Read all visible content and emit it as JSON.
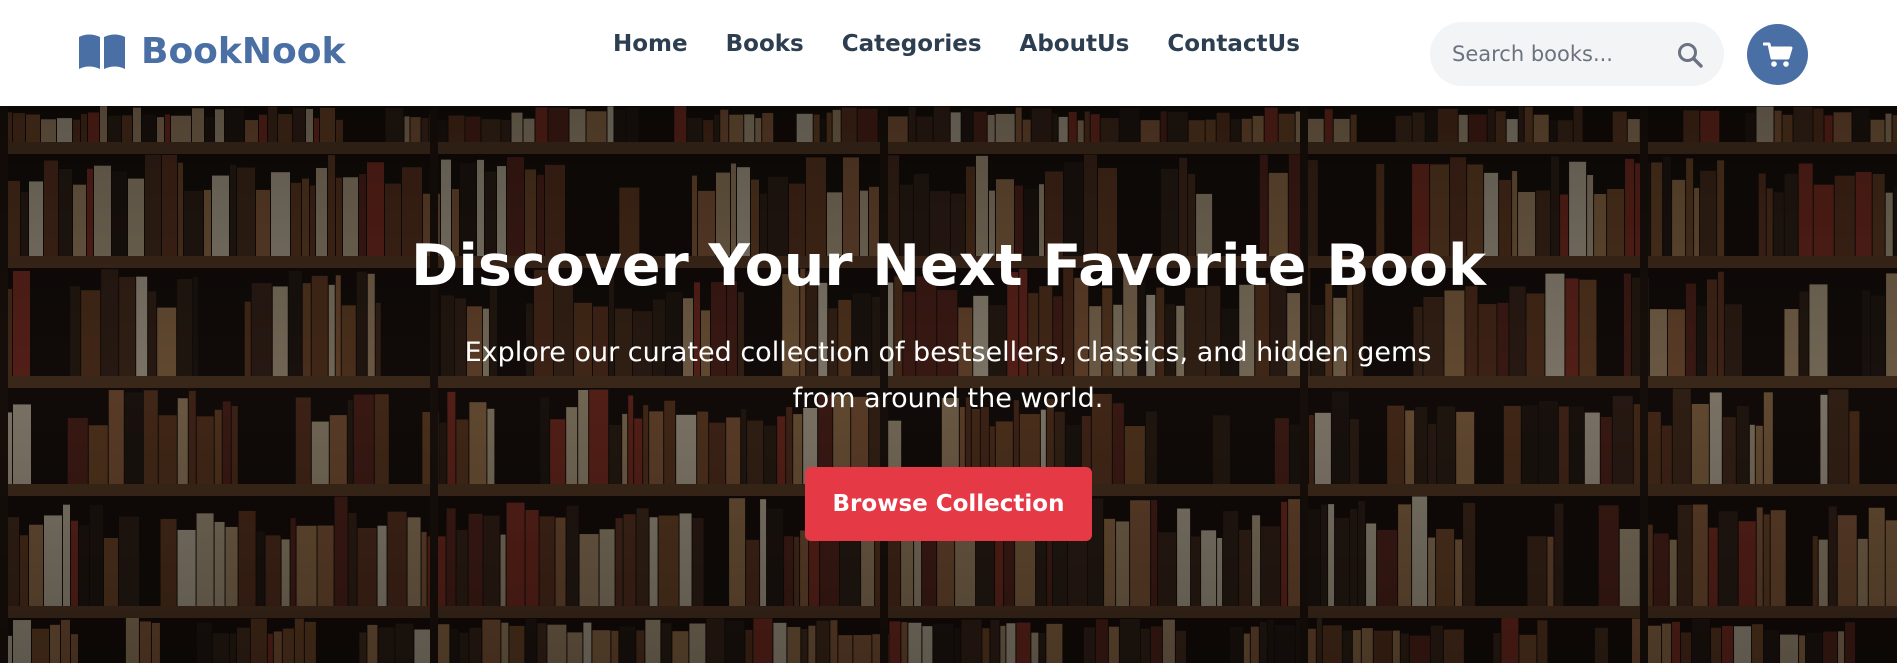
{
  "brand": {
    "name": "BookNook",
    "icon": "book-open-icon",
    "color": "#4a6fa5"
  },
  "nav": {
    "links": [
      {
        "label": "Home"
      },
      {
        "label": "Books"
      },
      {
        "label": "Categories"
      },
      {
        "label": "AboutUs"
      },
      {
        "label": "ContactUs"
      }
    ]
  },
  "search": {
    "placeholder": "Search books...",
    "value": "",
    "icon": "search-icon"
  },
  "cart": {
    "icon": "shopping-cart-icon",
    "color": "#4a6fa5"
  },
  "hero": {
    "background": "bookshelf-photo",
    "title": "Discover Your Next Favorite Book",
    "subtitle": "Explore our curated collection of bestsellers, classics, and hidden gems from around the world.",
    "cta_label": "Browse Collection",
    "cta_color": "#e63946"
  }
}
